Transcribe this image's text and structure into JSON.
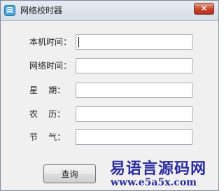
{
  "window": {
    "title": "网络校时器",
    "close_glyph": "✕",
    "app_icon": "app-icon"
  },
  "form": {
    "local_time": {
      "label": "本机时间：",
      "value": ""
    },
    "network_time": {
      "label": "网络时间：",
      "value": ""
    },
    "weekday": {
      "label": "星    期：",
      "value": ""
    },
    "lunar_date": {
      "label": "农    历：",
      "value": ""
    },
    "solar_term": {
      "label": "节    气：",
      "value": ""
    }
  },
  "actions": {
    "query_label": "查询"
  },
  "watermark": {
    "line1": "易语言源码网",
    "line2": "www.e5a5x.com"
  },
  "colors": {
    "watermark": "#2b2b9e",
    "close_button": "#c7432a"
  }
}
